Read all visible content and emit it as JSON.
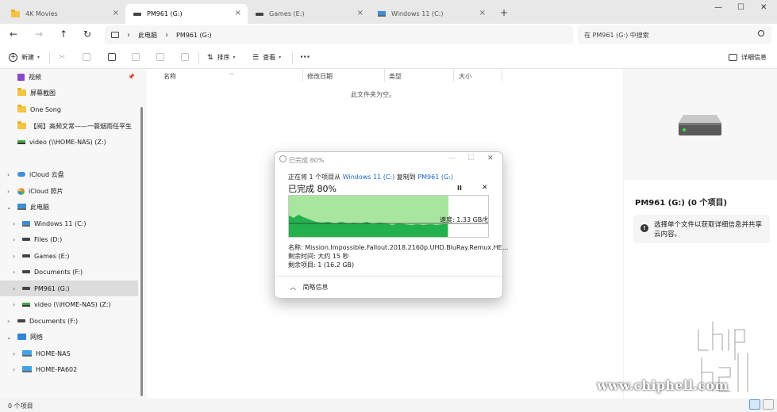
{
  "tabs": [
    {
      "label": "4K Movies",
      "icon": "folder-icon",
      "active": false
    },
    {
      "label": "PM961 (G:)",
      "icon": "drive-icon",
      "active": true
    },
    {
      "label": "Games (E:)",
      "icon": "drive-icon",
      "active": false
    },
    {
      "label": "Windows 11 (C:)",
      "icon": "windows-drive-icon",
      "active": false
    }
  ],
  "tab_close_glyph": "×",
  "new_tab_glyph": "+",
  "window_controls": {
    "minimize": "—",
    "maximize": "☐",
    "close": "✕"
  },
  "nav": {
    "back": "←",
    "forward": "→",
    "up": "↑",
    "refresh": "↻"
  },
  "breadcrumb": {
    "root": "此电脑",
    "current": "PM961 (G:)",
    "separator": "›"
  },
  "search": {
    "placeholder": "在 PM961 (G:) 中搜索"
  },
  "toolbar": {
    "new_label": "新建",
    "sort_label": "排序",
    "view_label": "查看",
    "more_label": "···",
    "details_label": "详细信息"
  },
  "sidebar": {
    "quick_access": [
      {
        "label": "视频",
        "icon": "video-folder-icon",
        "pinned": true
      },
      {
        "label": "屏幕截图",
        "icon": "folder-icon"
      },
      {
        "label": "One Song",
        "icon": "folder-icon"
      },
      {
        "label": "【阅】高频文常——一蓑烟雨任平生",
        "icon": "folder-icon"
      },
      {
        "label": "video (\\\\HOME-NAS) (Z:)",
        "icon": "network-drive-icon"
      }
    ],
    "icloud_drive": "iCloud 云盘",
    "icloud_photos": "iCloud 照片",
    "this_pc": "此电脑",
    "drives": [
      {
        "label": "Windows 11 (C:)",
        "icon": "windows-drive-icon"
      },
      {
        "label": "Files (D:)",
        "icon": "drive-icon"
      },
      {
        "label": "Games (E:)",
        "icon": "drive-icon"
      },
      {
        "label": "Documents (F:)",
        "icon": "drive-icon"
      },
      {
        "label": "PM961 (G:)",
        "icon": "drive-icon",
        "selected": true
      },
      {
        "label": "video (\\\\HOME-NAS) (Z:)",
        "icon": "network-drive-icon"
      }
    ],
    "documents_root": "Documents (F:)",
    "network": "网络",
    "network_hosts": [
      "HOME-NAS",
      "HOME-PA602"
    ]
  },
  "columns": [
    "名称",
    "修改日期",
    "类型",
    "大小"
  ],
  "empty_message": "此文件夹为空。",
  "details_pane": {
    "title": "PM961 (G:) (0 个项目)",
    "info": "选择单个文件以获取详细信息并共享云内容。",
    "info_glyph": "!"
  },
  "status_bar": {
    "item_count": "0 个项目"
  },
  "copy_dialog": {
    "window_title": "已完成 80%",
    "line_prefix": "正在将 1 个项目从",
    "source": "Windows 11 (C:)",
    "line_middle": "复制到",
    "destination": "PM961 (G:)",
    "percent_label": "已完成 80%",
    "progress": 0.8,
    "pause_glyph": "II",
    "stop_glyph": "✕",
    "speed_label": "速度: 1.33 GB/秒",
    "name_row": "名称: Mission.Impossible.Fallout.2018.2160p.UHD.BluRay.Remux.HE...",
    "time_row": "剩余时间: 大约 15 秒",
    "items_row": "剩余项目: 1 (16.2 GB)",
    "less_info_label": "简略信息",
    "less_info_glyph": "︿",
    "colors": {
      "fill": "#a8e6a0",
      "throughput": "#22b14c",
      "link": "#1a66c2"
    }
  },
  "watermark": {
    "site": "www.chiphell.com"
  }
}
